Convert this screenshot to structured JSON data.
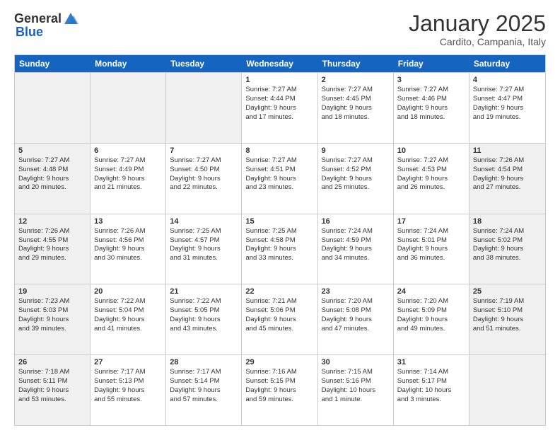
{
  "header": {
    "logo_general": "General",
    "logo_blue": "Blue",
    "month": "January 2025",
    "location": "Cardito, Campania, Italy"
  },
  "days_of_week": [
    "Sunday",
    "Monday",
    "Tuesday",
    "Wednesday",
    "Thursday",
    "Friday",
    "Saturday"
  ],
  "weeks": [
    [
      {
        "day": "",
        "info": "",
        "shaded": true
      },
      {
        "day": "",
        "info": "",
        "shaded": true
      },
      {
        "day": "",
        "info": "",
        "shaded": true
      },
      {
        "day": "1",
        "info": "Sunrise: 7:27 AM\nSunset: 4:44 PM\nDaylight: 9 hours\nand 17 minutes.",
        "shaded": false
      },
      {
        "day": "2",
        "info": "Sunrise: 7:27 AM\nSunset: 4:45 PM\nDaylight: 9 hours\nand 18 minutes.",
        "shaded": false
      },
      {
        "day": "3",
        "info": "Sunrise: 7:27 AM\nSunset: 4:46 PM\nDaylight: 9 hours\nand 18 minutes.",
        "shaded": false
      },
      {
        "day": "4",
        "info": "Sunrise: 7:27 AM\nSunset: 4:47 PM\nDaylight: 9 hours\nand 19 minutes.",
        "shaded": false
      }
    ],
    [
      {
        "day": "5",
        "info": "Sunrise: 7:27 AM\nSunset: 4:48 PM\nDaylight: 9 hours\nand 20 minutes.",
        "shaded": true
      },
      {
        "day": "6",
        "info": "Sunrise: 7:27 AM\nSunset: 4:49 PM\nDaylight: 9 hours\nand 21 minutes.",
        "shaded": false
      },
      {
        "day": "7",
        "info": "Sunrise: 7:27 AM\nSunset: 4:50 PM\nDaylight: 9 hours\nand 22 minutes.",
        "shaded": false
      },
      {
        "day": "8",
        "info": "Sunrise: 7:27 AM\nSunset: 4:51 PM\nDaylight: 9 hours\nand 23 minutes.",
        "shaded": false
      },
      {
        "day": "9",
        "info": "Sunrise: 7:27 AM\nSunset: 4:52 PM\nDaylight: 9 hours\nand 25 minutes.",
        "shaded": false
      },
      {
        "day": "10",
        "info": "Sunrise: 7:27 AM\nSunset: 4:53 PM\nDaylight: 9 hours\nand 26 minutes.",
        "shaded": false
      },
      {
        "day": "11",
        "info": "Sunrise: 7:26 AM\nSunset: 4:54 PM\nDaylight: 9 hours\nand 27 minutes.",
        "shaded": true
      }
    ],
    [
      {
        "day": "12",
        "info": "Sunrise: 7:26 AM\nSunset: 4:55 PM\nDaylight: 9 hours\nand 29 minutes.",
        "shaded": true
      },
      {
        "day": "13",
        "info": "Sunrise: 7:26 AM\nSunset: 4:56 PM\nDaylight: 9 hours\nand 30 minutes.",
        "shaded": false
      },
      {
        "day": "14",
        "info": "Sunrise: 7:25 AM\nSunset: 4:57 PM\nDaylight: 9 hours\nand 31 minutes.",
        "shaded": false
      },
      {
        "day": "15",
        "info": "Sunrise: 7:25 AM\nSunset: 4:58 PM\nDaylight: 9 hours\nand 33 minutes.",
        "shaded": false
      },
      {
        "day": "16",
        "info": "Sunrise: 7:24 AM\nSunset: 4:59 PM\nDaylight: 9 hours\nand 34 minutes.",
        "shaded": false
      },
      {
        "day": "17",
        "info": "Sunrise: 7:24 AM\nSunset: 5:01 PM\nDaylight: 9 hours\nand 36 minutes.",
        "shaded": false
      },
      {
        "day": "18",
        "info": "Sunrise: 7:24 AM\nSunset: 5:02 PM\nDaylight: 9 hours\nand 38 minutes.",
        "shaded": true
      }
    ],
    [
      {
        "day": "19",
        "info": "Sunrise: 7:23 AM\nSunset: 5:03 PM\nDaylight: 9 hours\nand 39 minutes.",
        "shaded": true
      },
      {
        "day": "20",
        "info": "Sunrise: 7:22 AM\nSunset: 5:04 PM\nDaylight: 9 hours\nand 41 minutes.",
        "shaded": false
      },
      {
        "day": "21",
        "info": "Sunrise: 7:22 AM\nSunset: 5:05 PM\nDaylight: 9 hours\nand 43 minutes.",
        "shaded": false
      },
      {
        "day": "22",
        "info": "Sunrise: 7:21 AM\nSunset: 5:06 PM\nDaylight: 9 hours\nand 45 minutes.",
        "shaded": false
      },
      {
        "day": "23",
        "info": "Sunrise: 7:20 AM\nSunset: 5:08 PM\nDaylight: 9 hours\nand 47 minutes.",
        "shaded": false
      },
      {
        "day": "24",
        "info": "Sunrise: 7:20 AM\nSunset: 5:09 PM\nDaylight: 9 hours\nand 49 minutes.",
        "shaded": false
      },
      {
        "day": "25",
        "info": "Sunrise: 7:19 AM\nSunset: 5:10 PM\nDaylight: 9 hours\nand 51 minutes.",
        "shaded": true
      }
    ],
    [
      {
        "day": "26",
        "info": "Sunrise: 7:18 AM\nSunset: 5:11 PM\nDaylight: 9 hours\nand 53 minutes.",
        "shaded": true
      },
      {
        "day": "27",
        "info": "Sunrise: 7:17 AM\nSunset: 5:13 PM\nDaylight: 9 hours\nand 55 minutes.",
        "shaded": false
      },
      {
        "day": "28",
        "info": "Sunrise: 7:17 AM\nSunset: 5:14 PM\nDaylight: 9 hours\nand 57 minutes.",
        "shaded": false
      },
      {
        "day": "29",
        "info": "Sunrise: 7:16 AM\nSunset: 5:15 PM\nDaylight: 9 hours\nand 59 minutes.",
        "shaded": false
      },
      {
        "day": "30",
        "info": "Sunrise: 7:15 AM\nSunset: 5:16 PM\nDaylight: 10 hours\nand 1 minute.",
        "shaded": false
      },
      {
        "day": "31",
        "info": "Sunrise: 7:14 AM\nSunset: 5:17 PM\nDaylight: 10 hours\nand 3 minutes.",
        "shaded": false
      },
      {
        "day": "",
        "info": "",
        "shaded": true
      }
    ]
  ]
}
